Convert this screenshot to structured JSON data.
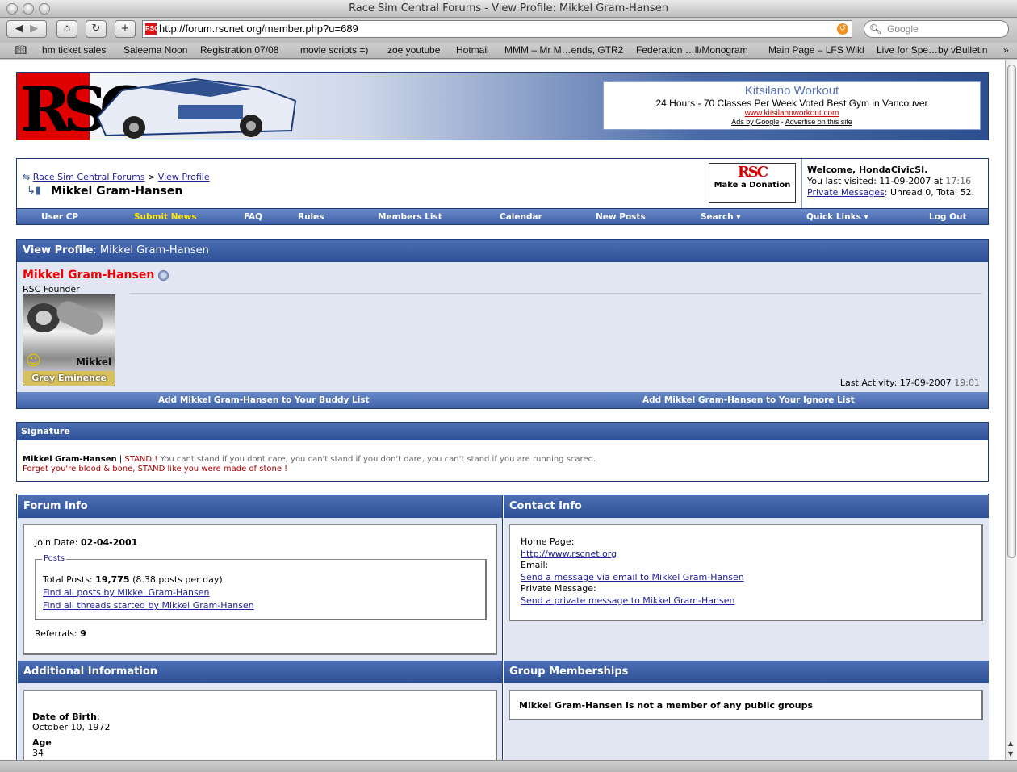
{
  "window": {
    "title": "Race Sim Central Forums - View Profile: Mikkel Gram-Hansen"
  },
  "browser": {
    "url": "http://forum.rscnet.org/member.php?u=689",
    "search_placeholder": "Google",
    "bookmarks": [
      "hm ticket sales",
      "Saleema Noon",
      "Registration 07/08",
      "movie scripts =)",
      "zoe youtube",
      "Hotmail",
      "MMM – Mr M…ends, GTR2",
      "Federation …ll/Monogram",
      "Main Page – LFS Wiki",
      "Live for Spe…by vBulletin"
    ]
  },
  "ad": {
    "title": "Kitsilano Workout",
    "desc": "24 Hours - 70 Classes Per Week Voted Best Gym in Vancouver",
    "url": "www.kitsilanoworkout.com",
    "ads_by": "Ads by Google",
    "sep": " - ",
    "advertise": "Advertise on this site"
  },
  "breadcrumb": {
    "home": "Race Sim Central Forums",
    "sep": ">",
    "current": "View Profile",
    "title": "Mikkel Gram-Hansen"
  },
  "donate": {
    "logo": "RSC",
    "label": "Make a Donation"
  },
  "welcome": {
    "greeting": "Welcome, HondaCivicSI.",
    "last_visited_label": "You last visited: 11-09-2007 at ",
    "last_visited_time": "17:16",
    "pm_link": "Private Messages",
    "pm_status": ": Unread 0, Total 52."
  },
  "nav": [
    "User CP",
    "Submit News",
    "FAQ",
    "Rules",
    "Members List",
    "Calendar",
    "New Posts",
    "Search ▾",
    "Quick Links ▾",
    "Log Out"
  ],
  "profile": {
    "header_label": "View Profile",
    "header_name": ": Mikkel Gram-Hansen",
    "name": "Mikkel Gram-Hansen",
    "rank": "RSC Founder",
    "avatar_name": "Mikkel",
    "avatar_title": "Grey Eminence",
    "last_activity_label": "Last Activity: 17-09-2007",
    "last_activity_time": "19:01",
    "add_buddy": "Add Mikkel Gram-Hansen to Your Buddy List",
    "add_ignore": "Add Mikkel Gram-Hansen to Your Ignore List"
  },
  "signature": {
    "header": "Signature",
    "name": "Mikkel Gram-Hansen",
    "pipe": " | ",
    "stand": "STAND !",
    "line1_rest": " You cant stand if you dont care, you can't stand if you don't dare, you can't stand if you are running scared.",
    "line2": "Forget you're blood & bone, STAND like you were made of stone !"
  },
  "forum_info": {
    "header": "Forum Info",
    "join_label": "Join Date: ",
    "join_date": "02-04-2001",
    "posts_legend": "Posts",
    "total_label": "Total Posts: ",
    "total_posts": "19,775",
    "per_day": " (8.38 posts per day)",
    "find_posts": "Find all posts by Mikkel Gram-Hansen",
    "find_threads": "Find all threads started by Mikkel Gram-Hansen",
    "referrals_label": "Referrals: ",
    "referrals": "9"
  },
  "contact_info": {
    "header": "Contact Info",
    "home_label": "Home Page:",
    "home_url": "http://www.rscnet.org",
    "email_label": "Email:",
    "email_link": "Send a message via email to Mikkel Gram-Hansen",
    "pm_label": "Private Message:",
    "pm_link": "Send a private message to Mikkel Gram-Hansen"
  },
  "additional": {
    "header": "Additional Information",
    "dob_label": "Date of Birth",
    "dob": "October 10, 1972",
    "age_label": "Age",
    "age": "34"
  },
  "groups": {
    "header": "Group Memberships",
    "text": "Mikkel Gram-Hansen is not a member of any public groups"
  },
  "colors": {
    "accent": "#2d4f95",
    "link": "#22229c",
    "name_red": "#e00000",
    "submit_news": "#ffe600"
  }
}
